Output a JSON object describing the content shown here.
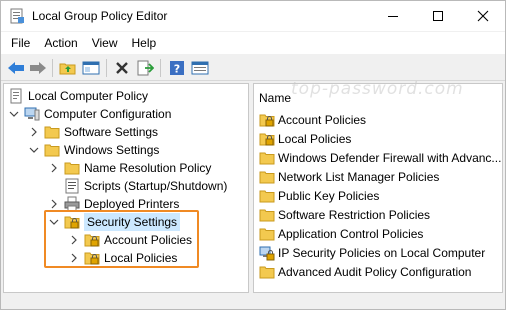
{
  "window": {
    "title": "Local Group Policy Editor",
    "icon": "policy-editor-icon"
  },
  "menubar": {
    "items": [
      "File",
      "Action",
      "View",
      "Help"
    ]
  },
  "toolbar": {
    "buttons": [
      "back-icon",
      "forward-icon",
      "up-folder-icon",
      "show-hide-tree-icon",
      "delete-icon",
      "export-list-icon",
      "help-icon",
      "properties-icon"
    ]
  },
  "watermark": "top-password.com",
  "tree": {
    "items": [
      {
        "label": "Local Computer Policy",
        "icon": "computer-policy-icon"
      },
      {
        "label": "Computer Configuration",
        "icon": "computer-icon",
        "expanded": true
      },
      {
        "label": "Software Settings",
        "icon": "folder-icon",
        "expanded": false
      },
      {
        "label": "Windows Settings",
        "icon": "folder-icon",
        "expanded": true
      },
      {
        "label": "Name Resolution Policy",
        "icon": "folder-icon",
        "expanded": false
      },
      {
        "label": "Scripts (Startup/Shutdown)",
        "icon": "scripts-icon"
      },
      {
        "label": "Deployed Printers",
        "icon": "printer-icon",
        "expanded": false
      },
      {
        "label": "Security Settings",
        "icon": "security-folder-icon",
        "expanded": true,
        "selected": true
      },
      {
        "label": "Account Policies",
        "icon": "locked-folder-icon",
        "expanded": false
      },
      {
        "label": "Local Policies",
        "icon": "locked-folder-icon",
        "expanded": false
      }
    ]
  },
  "list": {
    "header": "Name",
    "items": [
      {
        "label": "Account Policies",
        "icon": "locked-folder-icon"
      },
      {
        "label": "Local Policies",
        "icon": "locked-folder-icon"
      },
      {
        "label": "Windows Defender Firewall with Advanc...",
        "icon": "folder-icon"
      },
      {
        "label": "Network List Manager Policies",
        "icon": "folder-icon"
      },
      {
        "label": "Public Key Policies",
        "icon": "folder-icon"
      },
      {
        "label": "Software Restriction Policies",
        "icon": "folder-icon"
      },
      {
        "label": "Application Control Policies",
        "icon": "folder-icon"
      },
      {
        "label": "IP Security Policies on Local Computer",
        "icon": "ip-security-icon"
      },
      {
        "label": "Advanced Audit Policy Configuration",
        "icon": "folder-icon"
      }
    ]
  },
  "colors": {
    "selection": "#cce8ff",
    "highlight_box": "#f08a24",
    "folder": "#f3c94f",
    "arrow_blue": "#2f7ed8"
  }
}
